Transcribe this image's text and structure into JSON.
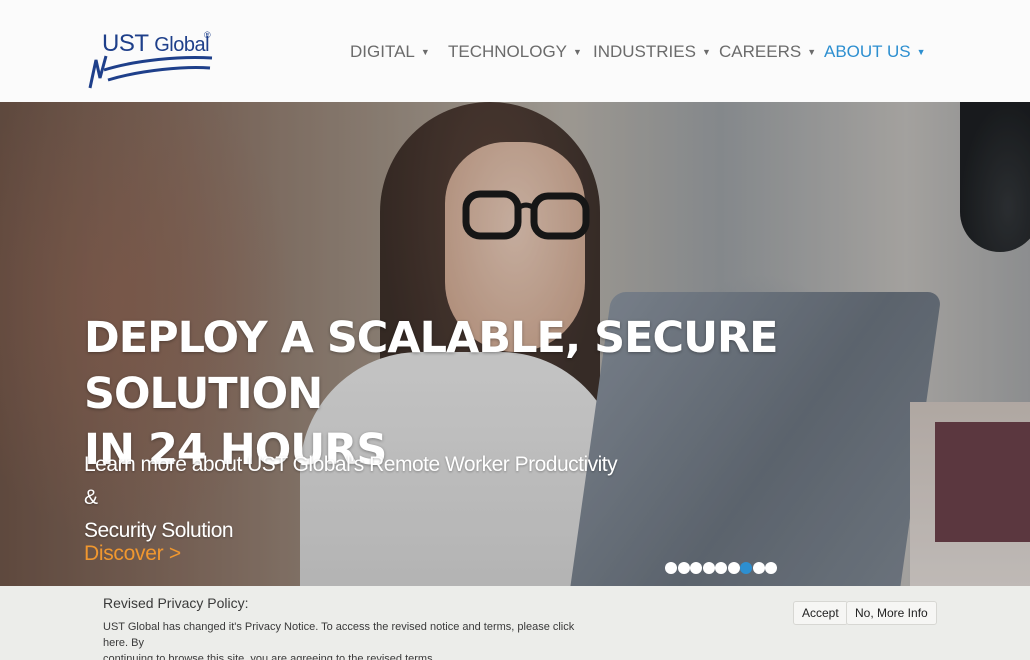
{
  "header": {
    "logo": {
      "text_main": "UST",
      "text_secondary": "Global",
      "registered": "®"
    },
    "nav": [
      {
        "label": "DIGITAL"
      },
      {
        "label": "TECHNOLOGY"
      },
      {
        "label": "INDUSTRIES"
      },
      {
        "label": "CAREERS"
      },
      {
        "label": "ABOUT US",
        "active": true
      }
    ]
  },
  "hero": {
    "title_line1": "DEPLOY A SCALABLE, SECURE SOLUTION",
    "title_line2": "IN 24 HOURS",
    "subtitle_line1": "Learn more about UST Global's Remote Worker Productivity &",
    "subtitle_line2": "Security Solution",
    "cta": "Discover >",
    "carousel": {
      "total": 9,
      "active_index": 6
    }
  },
  "privacy": {
    "title": "Revised Privacy Policy:",
    "text_line1": "UST Global has changed it's Privacy Notice. To access the revised notice and terms, please click here. By",
    "text_line2": "continuing to browse this site, you are agreeing to the revised terms.",
    "accept_label": "Accept",
    "more_info_label": "No, More Info"
  },
  "colors": {
    "brand_blue": "#1e3f8a",
    "active_nav": "#2d8fd0",
    "cta_orange": "#f0972f",
    "nav_text": "#6b6b6b"
  }
}
